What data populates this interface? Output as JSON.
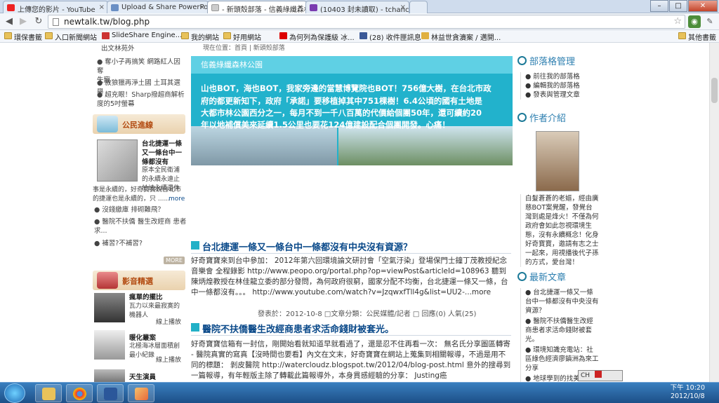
{
  "tabs": [
    {
      "label": "上傳您的影片 - YouTube",
      "icon_color": "#e22"
    },
    {
      "label": "Upload & Share PowerPo",
      "icon_color": "#6a8fc4"
    },
    {
      "label": "- 新頭殼部落 - 信義綠纖森林",
      "icon_color": "#cccccc"
    },
    {
      "label": "(10403 封未讀取) - tchanc",
      "icon_color": "#7a3bb0"
    }
  ],
  "address": {
    "url": "newtalk.tw/blog.php"
  },
  "bookmarks": [
    {
      "label": "環保書籤",
      "icon": "folder-icon"
    },
    {
      "label": "入口新聞網站",
      "icon": "folder-icon"
    },
    {
      "label": "SlideShare Engine...",
      "icon": "slideshare-icon"
    },
    {
      "label": "我的網站",
      "icon": "folder-icon"
    },
    {
      "label": "好用網站",
      "icon": "folder-icon"
    },
    {
      "label": "為何列為保護級 冰...",
      "icon": "youtube-icon"
    },
    {
      "label": "(28) 收件匣訊息",
      "icon": "facebook-icon"
    },
    {
      "label": "林益世貪瀆案 / 邁開...",
      "icon": "page-icon"
    },
    {
      "label": "其他書籤",
      "icon": "folder-icon"
    }
  ],
  "left": {
    "top_items": [
      "出文林苑外",
      "● 奪小子再搞笑 網路紅人因奪\n失寵",
      "● 敘狼獵再淨土國 土耳其選舉",
      "● 超充眼！Sharp撥超商解析\n度的5吋螢幕"
    ],
    "section1_title": "公民進線",
    "feature_title": "台北捷運一條\n又一條台中一\n條都沒有",
    "feature_body": "原本全民衛浦\n的永續永遠止\n於該永續還件",
    "feature_tail": "事是永續的，好奇寶寶說台北市\n的捷運也是永續的，只 ......",
    "feature_more": "more",
    "list_items": [
      "● 沒錢繳庫 排砌難飛？",
      "● 醫院不扶僑 醫生改經商 患者\n求...",
      "● 補習?不補習?"
    ],
    "more_label": "MORE",
    "section2_title": "影音精選",
    "videos": [
      {
        "title": "瘋單的擺比",
        "desc": "瓦力以來最寂寞的\n機器人",
        "action": "線上播放"
      },
      {
        "title": "暖化叢案",
        "desc": "北極海冰層面積創\n最小紀錄",
        "action": "線上播放"
      },
      {
        "title": "天生演員",
        "desc": "",
        "action": ""
      }
    ]
  },
  "main": {
    "breadcrumb": "現在位置：首頁 | 新頭殼部落",
    "banner_title": "信義綠纖森林公園",
    "banner_lines": [
      "山也BOT，海也BOT，我家旁邊的當慧博覽院也BOT！756億大樹，在台北市政",
      "府的都更新知下，政府「承諾」要移植掉其中751棵樹！6.4公頃的國有土地是",
      "大都市林公園西分之一，每月不到一千八百萬的代價給個團50年，還可續約20",
      "年以地補償美來延續1.5公里也要花124億建設配合個團開發。心痛！"
    ],
    "posts": [
      {
        "title": "台北捷運一條又一條台中一條都沒有中央沒有資源？",
        "body": "好奇寶寶來到台中參加： 2012年第六回環境論文研討會「空氣汙染」登場保門士鐘丁茂教授紀念音樂會 全程錄影 http://www.peopo.org/portal.php?op=viewPost&articleId=108963 聽到陳炳煌教授在林佳龍立委的部分發問，為何政府很窮，國家分配不均衡，台北捷運一條又一條，台中一條都沒有。。。 http://www.youtube.com/watch?v=JzqwxfTll4g&list=UU2-...more",
        "meta": "發表於：2012-10-8 □文章分類：公民媒體/記者 □ 回應(0) 人氣(25)"
      },
      {
        "title": "醫院不扶僑醫生改經商患者求活命錢財被套光。",
        "body": "好奇寶寶信箱有一封信，剛開始看就知道早就看過了，還是忍不住再看一次： 無名氏分享圖區轉寄 - 醫院真實的寫真【沒時間也要看】內文在文末，好奇寶寶在網站上蒐集到相關報導，不過是用不同的標題： 剝皮醫院 http://watercloudz.blogspot.tw/2012/04/blog-post.html 意外的搜尋到一篇報導，有年輕版主除了轉載此篇報導外，本身貫感經驗的分享： Justing癌",
        "meta": ""
      }
    ]
  },
  "right": {
    "blog_mgmt_title": "部落格管理",
    "blog_mgmt_items": [
      "● 前往我的部落格",
      "● 編輯我的部落格",
      "● 發表與管理文章"
    ],
    "author_title": "作者介紹",
    "author_bio": "白髮蒼蒼的老嫗，經由廣慈BOT案覺醒，發覺台灣到處是烽火！不僅為何政府會如此忽視環境生態，沒有永續概念！化身好奇寶寶，邀請有志之士一起來，用視播後代子孫的方式，愛台灣！",
    "latest_title": "最新文章",
    "latest_items": [
      "● 台北捷運一條又一條台中一條都沒有中央沒有資源？",
      "● 醫院不扶僑醫生改經商患者求活命錢財被套光。",
      "● 環境知識充電站：社區綠色經濟廖鎮洲為來工分享",
      "● 地球學到的找美好山尋共上天堂Justing"
    ]
  },
  "taskbar": {
    "apps": [
      "windows-explorer",
      "chrome",
      "word",
      "paint"
    ],
    "ime": "CH",
    "time": "下午 10:20",
    "date": "2012/10/8"
  },
  "colors": {
    "accent": "#22b2cc",
    "link": "#0b4a8a",
    "orange": "#b24a10"
  }
}
